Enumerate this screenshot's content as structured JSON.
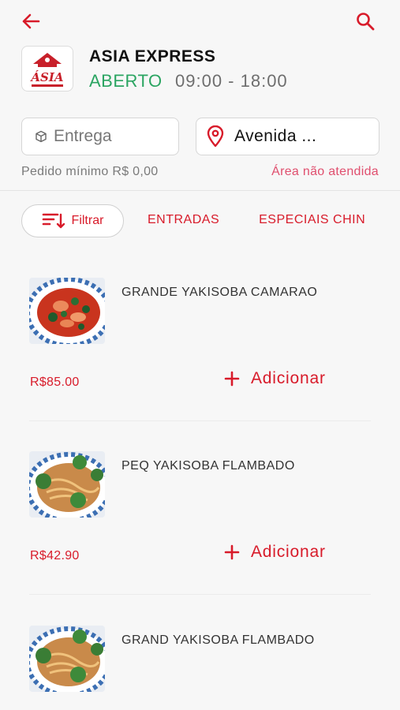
{
  "header": {
    "back_icon": "arrow-left-icon",
    "search_icon": "search-icon",
    "accent_color": "#d81b2a"
  },
  "store": {
    "name": "ASIA EXPRESS",
    "status": "ABERTO",
    "hours": "09:00 - 18:00",
    "logo_text": "ÁSIA",
    "status_color": "#2ba562"
  },
  "delivery": {
    "mode_label": "Entrega",
    "address_label": "Avenida ...",
    "min_order": "Pedido mínimo R$ 0,00",
    "area_status": "Área não atendida"
  },
  "filter": {
    "label": "Filtrar"
  },
  "tabs": [
    "ENTRADAS",
    "ESPECIAIS CHIN"
  ],
  "products": [
    {
      "name": "GRANDE YAKISOBA CAMARAO",
      "price": "R$85.00",
      "add_label": "Adicionar"
    },
    {
      "name": "PEQ YAKISOBA FLAMBADO",
      "price": "R$42.90",
      "add_label": "Adicionar"
    },
    {
      "name": "GRAND YAKISOBA FLAMBADO"
    }
  ]
}
